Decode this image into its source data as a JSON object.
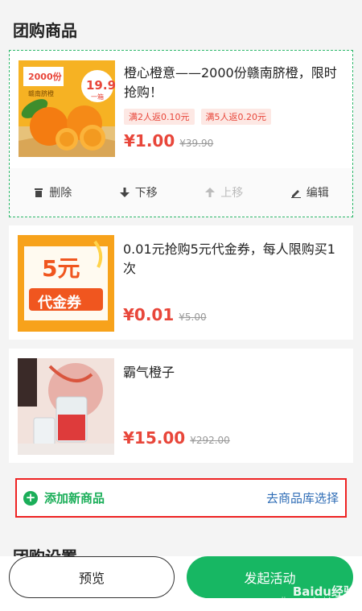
{
  "section_title": "团购商品",
  "products": [
    {
      "title": "橙心橙意——2000份赣南脐橙，限时抢购！",
      "tags": [
        "满2人返0.10元",
        "满5人返0.20元"
      ],
      "price": "¥1.00",
      "original_price": "¥39.90",
      "image_text": {
        "badge": "19.9",
        "badge_sub": "一箱",
        "banner": "2000份",
        "caption": "赣南脐橙"
      },
      "selected": true,
      "actions": {
        "delete": "删除",
        "move_down": "下移",
        "move_up": "上移",
        "edit": "编辑"
      }
    },
    {
      "title": "0.01元抢购5元代金券，每人限购买1次",
      "tags": [],
      "price": "¥0.01",
      "original_price": "¥5.00",
      "image_text": {
        "amount": "5元",
        "label": "代金券"
      }
    },
    {
      "title": "霸气橙子",
      "tags": [],
      "price": "¥15.00",
      "original_price": "¥292.00"
    }
  ],
  "add_product": {
    "label": "添加新商品",
    "library_link": "去商品库选择"
  },
  "settings_title": "团购设置",
  "bottom": {
    "preview": "预览",
    "launch": "发起活动"
  },
  "watermark": {
    "brand": "Baidu经验",
    "url": "jingyan.baidu.com"
  },
  "colors": {
    "accent_green": "#17b763",
    "price_red": "#e8463a",
    "link_blue": "#2f6db6",
    "highlight_red": "#ee2222"
  }
}
